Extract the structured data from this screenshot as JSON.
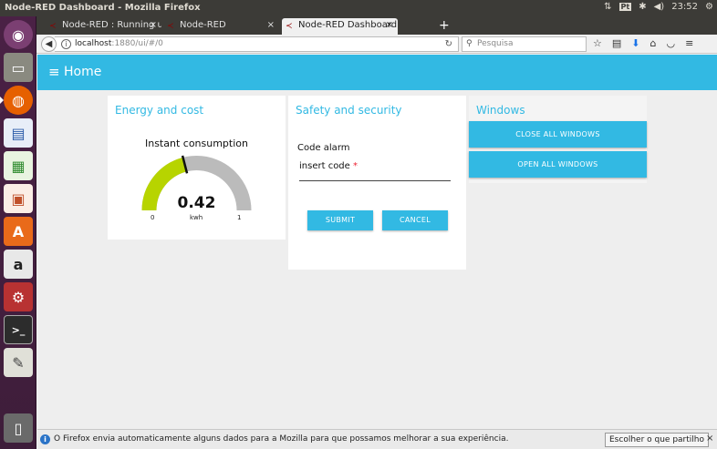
{
  "window": {
    "title": "Node-RED Dashboard - Mozilla Firefox"
  },
  "tray": {
    "keyboard": "Pt",
    "clock": "23:52"
  },
  "tabs": [
    {
      "label": "Node-RED : Running u",
      "close": "×"
    },
    {
      "label": "Node-RED",
      "close": "×"
    },
    {
      "label": "Node-RED Dashboard",
      "close": "×"
    }
  ],
  "new_tab": "+",
  "address": {
    "host": "localhost",
    "path": ":1880/ui/#/0"
  },
  "search": {
    "placeholder": "Pesquisa"
  },
  "app": {
    "title": "Home"
  },
  "groups": {
    "energy": {
      "title": "Energy and cost",
      "gauge_title": "Instant consumption",
      "value": "0.42",
      "value_fraction": 0.42,
      "min": "0",
      "max": "1",
      "unit": "kwh",
      "fill_color": "#b7d400",
      "track_color": "#bbbbbb"
    },
    "safety": {
      "title": "Safety and security",
      "code_label": "Code alarm",
      "code_placeholder": "insert code",
      "required_mark": "*",
      "submit": "SUBMIT",
      "cancel": "CANCEL"
    },
    "windows": {
      "title": "Windows",
      "close_all": "CLOSE ALL WINDOWS",
      "open_all": "OPEN ALL WINDOWS"
    }
  },
  "notification": {
    "message": "O Firefox envia automaticamente alguns dados para a Mozilla para que possamos melhorar a sua experiência.",
    "button": "Escolher o que partilho",
    "close": "×"
  },
  "colors": {
    "accent": "#32b9e3",
    "launcher": "#4a2145"
  }
}
